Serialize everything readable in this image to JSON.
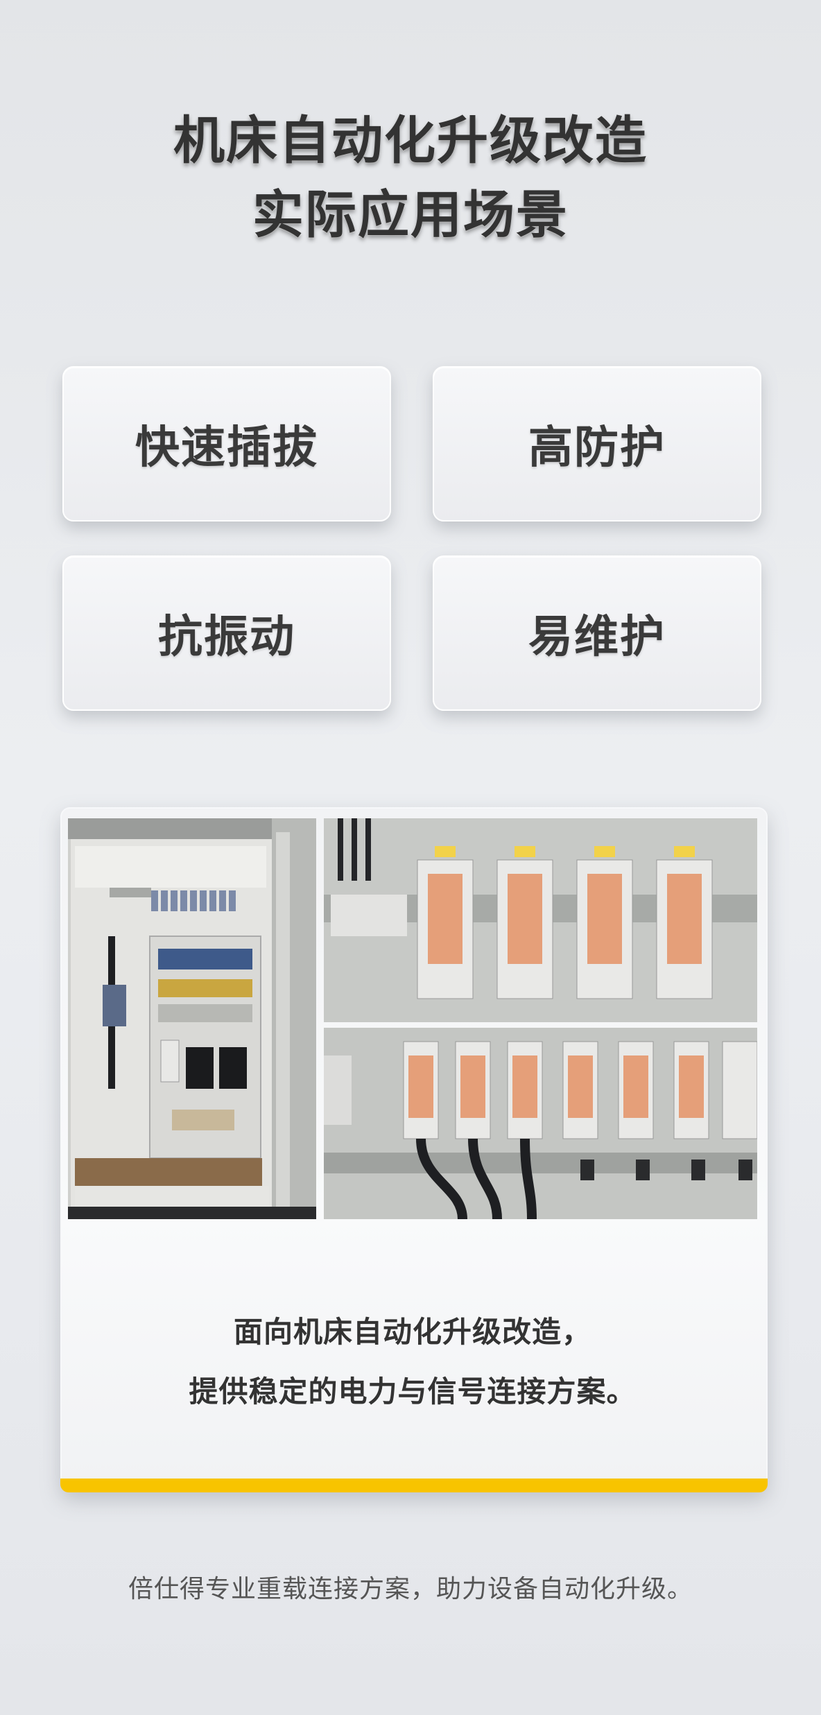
{
  "title": {
    "line1": "机床自动化升级改造",
    "line2": "实际应用场景"
  },
  "features": [
    {
      "label": "快速插拔"
    },
    {
      "label": "高防护"
    },
    {
      "label": "抗振动"
    },
    {
      "label": "易维护"
    }
  ],
  "caption": {
    "line1": "面向机床自动化升级改造，",
    "line2": "提供稳定的电力与信号连接方案。"
  },
  "footer": {
    "text": "倍仕得专业重载连接方案，助力设备自动化升级。"
  },
  "colors": {
    "accent": "#f8c400",
    "text": "#333333"
  }
}
